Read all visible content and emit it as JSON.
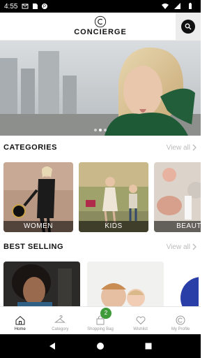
{
  "status_bar": {
    "time": "4:55"
  },
  "header": {
    "app_name": "CONCIERGE",
    "search_icon": "search-icon"
  },
  "hero": {
    "slide_count": 3,
    "active_slide": 2
  },
  "categories": {
    "title": "CATEGORIES",
    "view_all": "View all",
    "items": [
      {
        "label": "WOMEN"
      },
      {
        "label": "KIDS"
      },
      {
        "label": "BEAUT"
      }
    ]
  },
  "best_selling": {
    "title": "BEST SELLING",
    "view_all": "View all"
  },
  "tabs": [
    {
      "label": "Home",
      "icon": "home-icon",
      "active": true
    },
    {
      "label": "Category",
      "icon": "hanger-icon"
    },
    {
      "label": "Shopping Bag",
      "icon": "bag-icon",
      "badge": "2"
    },
    {
      "label": "Wishlist",
      "icon": "heart-icon"
    },
    {
      "label": "My Profile",
      "icon": "profile-icon"
    }
  ],
  "colors": {
    "badge": "#3f9a3a",
    "accent": "#111111"
  }
}
